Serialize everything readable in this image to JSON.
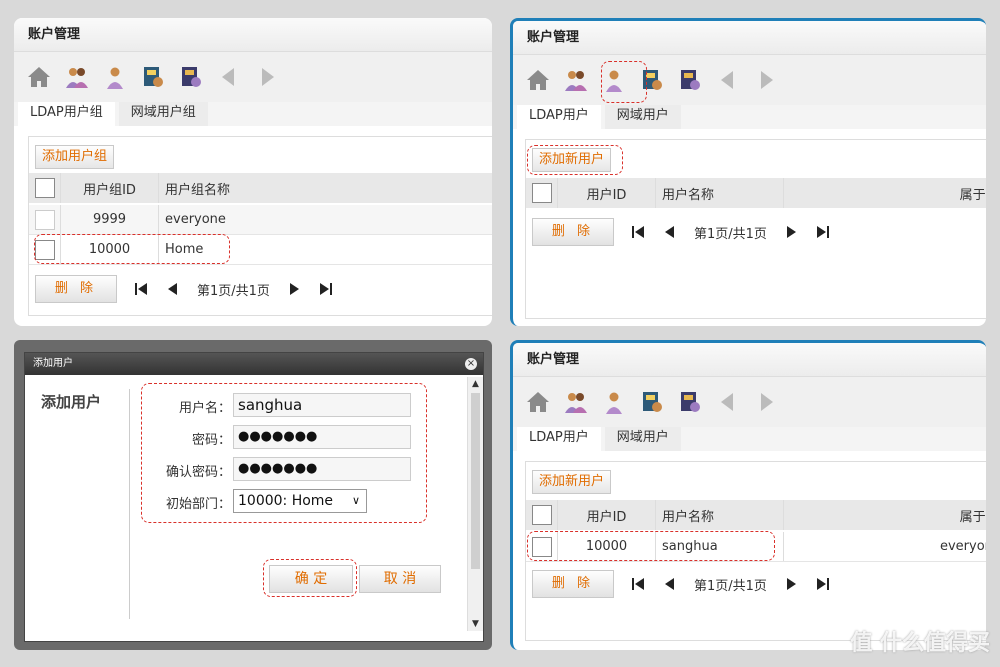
{
  "panel_tl": {
    "title": "账户管理",
    "tabs": [
      "LDAP用户组",
      "网域用户组"
    ],
    "add_button": "添加用户组",
    "columns": [
      "用户组ID",
      "用户组名称"
    ],
    "rows": [
      {
        "id": "9999",
        "name": "everyone"
      },
      {
        "id": "10000",
        "name": "Home"
      }
    ],
    "delete_label": "删 除",
    "page_text": "第1页/共1页"
  },
  "panel_tr": {
    "title": "账户管理",
    "tabs": [
      "LDAP用户",
      "网域用户"
    ],
    "add_button": "添加新用户",
    "columns": [
      "用户ID",
      "用户名称",
      "属于|"
    ],
    "delete_label": "删 除",
    "page_text": "第1页/共1页"
  },
  "dialog": {
    "title": "添加用户",
    "heading": "添加用户",
    "fields": [
      {
        "label": "用户名：",
        "value": "sanghua"
      },
      {
        "label": "密码：",
        "value": "●●●●●●●"
      },
      {
        "label": "确认密码：",
        "value": "●●●●●●●"
      },
      {
        "label": "初始部门：",
        "value": "10000: Home"
      }
    ],
    "ok_label": "确 定",
    "cancel_label": "取 消"
  },
  "panel_br": {
    "title": "账户管理",
    "tabs": [
      "LDAP用户",
      "网域用户"
    ],
    "add_button": "添加新用户",
    "columns": [
      "用户ID",
      "用户名称",
      "属于|"
    ],
    "rows": [
      {
        "id": "10000",
        "name": "sanghua",
        "belongs": "everyor"
      }
    ],
    "delete_label": "删 除",
    "page_text": "第1页/共1页"
  },
  "watermark": "值 什么值得买",
  "colors": {
    "accent": "#e06c00",
    "frame": "#1f7fb8",
    "dash": "#d9302a"
  }
}
